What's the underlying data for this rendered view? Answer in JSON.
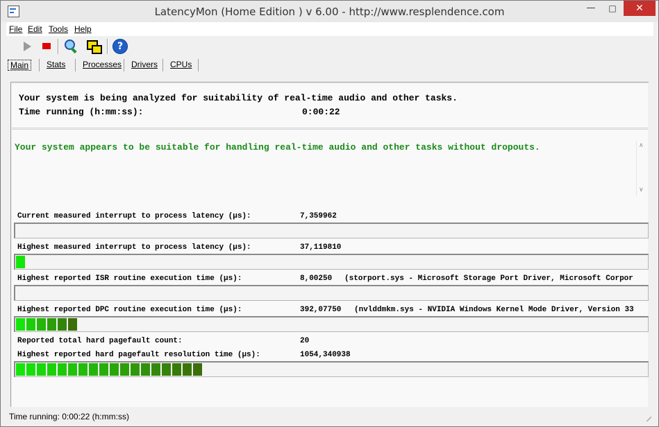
{
  "window": {
    "title": "LatencyMon  (Home Edition )  v 6.00 - http://www.resplendence.com"
  },
  "menu": [
    {
      "label": "File"
    },
    {
      "label": "Edit"
    },
    {
      "label": "Tools"
    },
    {
      "label": "Help"
    }
  ],
  "toolbar": {
    "icons": [
      "play-icon",
      "stop-icon",
      "analyze-icon",
      "windows-icon",
      "help-icon"
    ]
  },
  "tabs": [
    {
      "label": "Main",
      "active": true
    },
    {
      "label": "Stats"
    },
    {
      "label": "Processes"
    },
    {
      "label": "Drivers"
    },
    {
      "label": "CPUs"
    }
  ],
  "main": {
    "status_line": "Your system is being analyzed for suitability of real-time audio and other tasks.",
    "time_label": "Time running (h:mm:ss):",
    "time_value": "0:00:22",
    "verdict": "Your system appears to be suitable for handling real-time audio and other tasks without dropouts.",
    "verdict_color": "#1a8a1a"
  },
  "metrics": [
    {
      "label": "Current measured interrupt to process latency (µs):",
      "value": "7,359962",
      "desc": "",
      "bar_fraction": 0.0
    },
    {
      "label": "Highest measured interrupt to process latency (µs):",
      "value": "37,119810",
      "desc": "",
      "bar_fraction": 0.015
    },
    {
      "label": "Highest reported ISR routine execution time (µs):",
      "value": "8,00250",
      "desc": "(storport.sys - Microsoft Storage Port Driver, Microsoft Corpor",
      "bar_fraction": 0.0
    },
    {
      "label": "Highest reported DPC routine execution time (µs):",
      "value": "392,07750",
      "desc": "(nvlddmkm.sys - NVIDIA Windows Kernel Mode Driver, Version 33",
      "bar_fraction": 0.1
    },
    {
      "label": "Reported total hard pagefault count:",
      "value": "20",
      "desc": ""
    },
    {
      "label": "Highest reported hard pagefault resolution time (µs):",
      "value": "1054,340938",
      "desc": "",
      "bar_fraction": 0.3
    }
  ],
  "statusbar": {
    "text": "Time running: 0:00:22  (h:mm:ss)"
  }
}
